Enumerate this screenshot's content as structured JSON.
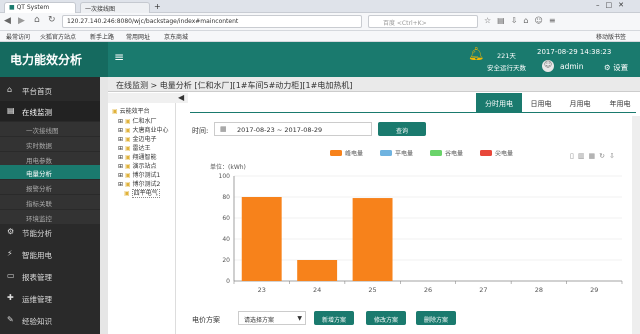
{
  "browser": {
    "tab1": "QT System",
    "tab2": "一次接线图",
    "url": "120.27.140.246:8080/wjc/backstage/index#maincontent",
    "search_placeholder": "百度 <Ctrl+K>",
    "bookmarks": [
      "最常访问",
      "火狐官方站点",
      "新手上路",
      "常用网址",
      "京东商城"
    ],
    "mobile_bookmarks": "移动版书签"
  },
  "header": {
    "logo": "电力能效分析",
    "menu_icon": "≡",
    "days": "221天",
    "days_label": "安全运行天数",
    "datetime": "2017-08-29 14:38:23",
    "user": "admin",
    "settings": "设置"
  },
  "sidebar": {
    "items": [
      {
        "icon": "⌂",
        "label": "平台首页"
      },
      {
        "icon": "▤",
        "label": "在线监测"
      },
      {
        "icon": "⚙",
        "label": "节能分析"
      },
      {
        "icon": "⚡",
        "label": "智能用电"
      },
      {
        "icon": "▭",
        "label": "报表管理"
      },
      {
        "icon": "✚",
        "label": "运维管理"
      },
      {
        "icon": "✎",
        "label": "经验知识"
      }
    ],
    "subitems": [
      "一次接线图",
      "实时数据",
      "用电参数",
      "电量分析",
      "报警分析",
      "指标关联",
      "环境监控"
    ]
  },
  "tree": {
    "root": "云能效平台",
    "nodes": [
      "仁和水厂",
      "大唐商业中心",
      "金迈电子",
      "雷达王",
      "翔通智能",
      "演示站点",
      "博尔测试1",
      "博尔测试2",
      "四平电气"
    ]
  },
  "breadcrumb": "在线监测 > 电量分析 [仁和水厂][1#车间5#动力柜][1#电加热机]",
  "period_tabs": [
    "分时用电",
    "日用电",
    "月用电",
    "年用电"
  ],
  "filter": {
    "time_label": "时间:",
    "date_range": "2017-08-23 ~ 2017-08-29",
    "query": "查询"
  },
  "tariff": {
    "label": "电价方案",
    "select_placeholder": "请选择方案",
    "buttons": [
      "新增方案",
      "修改方案",
      "删除方案"
    ]
  },
  "chart_data": {
    "type": "bar",
    "ylabel": "单位：(kWh)",
    "ylim": [
      0,
      100
    ],
    "yticks": [
      0,
      20,
      40,
      60,
      80,
      100
    ],
    "categories": [
      "23",
      "24",
      "25",
      "26",
      "27",
      "28",
      "29"
    ],
    "series": [
      {
        "name": "峰电量",
        "color": "#f7821b",
        "values": [
          80,
          20,
          79,
          0,
          0,
          0,
          0
        ]
      },
      {
        "name": "平电量",
        "color": "#6fb3e0",
        "values": [
          0,
          0,
          0,
          0,
          0,
          0,
          0
        ]
      },
      {
        "name": "谷电量",
        "color": "#6ad36a",
        "values": [
          0,
          0,
          0,
          0,
          0,
          0,
          0
        ]
      },
      {
        "name": "尖电量",
        "color": "#e8473a",
        "values": [
          0,
          0,
          0,
          0,
          0,
          0,
          0
        ]
      }
    ]
  }
}
